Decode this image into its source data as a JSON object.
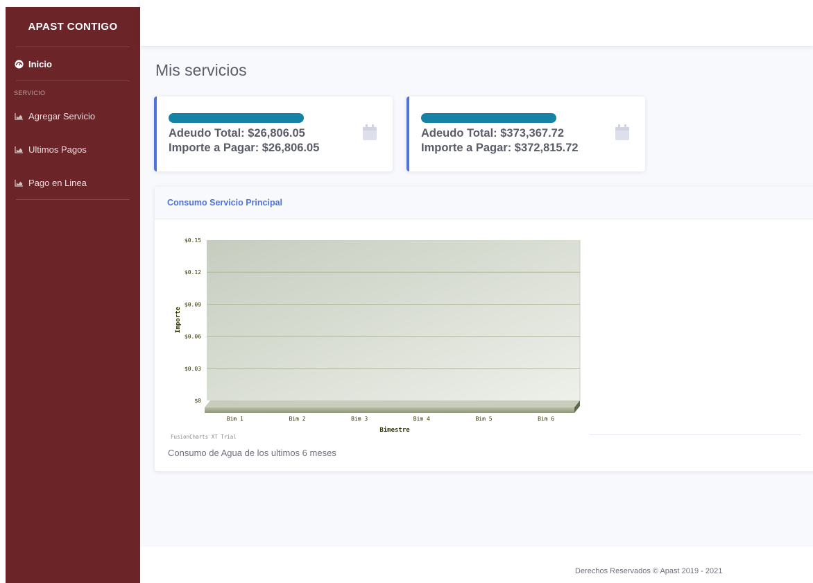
{
  "sidebar": {
    "brand": "APAST CONTIGO",
    "active_item": {
      "label": "Inicio",
      "icon": "tachometer-icon"
    },
    "section_heading": "SERVICIO",
    "items": [
      {
        "label": "Agregar Servicio",
        "icon": "chart-area-icon"
      },
      {
        "label": "Ultimos Pagos",
        "icon": "chart-area-icon"
      },
      {
        "label": "Pago en Linea",
        "icon": "chart-area-icon"
      }
    ]
  },
  "main": {
    "title": "Mis servicios",
    "cards": [
      {
        "adeudo": "Adeudo Total: $26,806.05",
        "importe": "Importe a Pagar: $26,806.05",
        "icon": "calendar-icon"
      },
      {
        "adeudo": "Adeudo Total: $373,367.72",
        "importe": "Importe a Pagar: $372,815.72",
        "icon": "calendar-icon"
      }
    ],
    "chart_card": {
      "title": "Consumo Servicio Principal",
      "caption": "Consumo de Agua de los ultimos 6 meses",
      "watermark": "FusionCharts XT Trial"
    }
  },
  "footer": {
    "text": "Derechos Reservados © Apast 2019 - 2021"
  },
  "colors": {
    "sidebar_bg": "#6b2427",
    "accent": "#4e73df",
    "card_bar": "#1582a6",
    "chart_text": "#333300"
  },
  "chart_data": {
    "type": "bar",
    "title": "",
    "xlabel": "Bimestre",
    "ylabel": "Importe",
    "categories": [
      "Bim 1",
      "Bim 2",
      "Bim 3",
      "Bim 4",
      "Bim 5",
      "Bim 6"
    ],
    "values": [
      0,
      0,
      0,
      0,
      0,
      0
    ],
    "ylim": [
      0,
      0.15
    ],
    "yticks": [
      "$0",
      "$0.03",
      "$0.06",
      "$0.09",
      "$0.12",
      "$0.15"
    ],
    "ytick_values": [
      0,
      0.03,
      0.06,
      0.09,
      0.12,
      0.15
    ],
    "grid": true
  }
}
